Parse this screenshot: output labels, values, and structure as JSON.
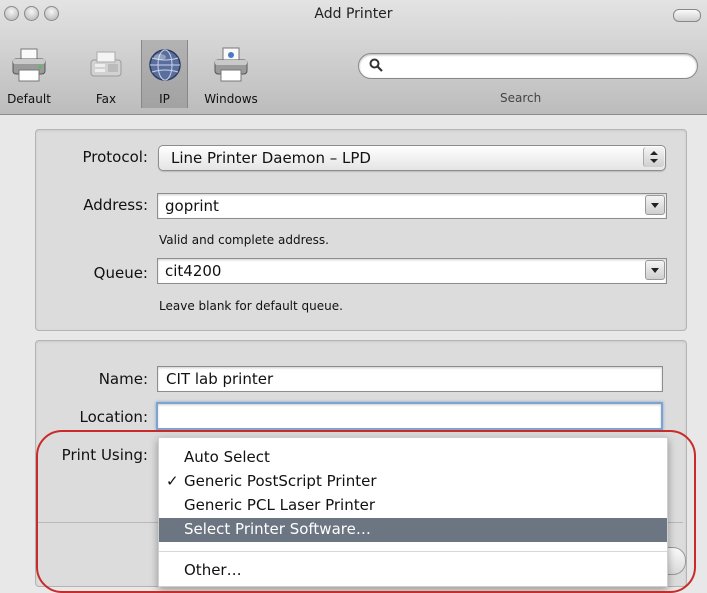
{
  "window": {
    "title": "Add Printer"
  },
  "toolbar": {
    "items": [
      {
        "label": "Default",
        "icon": "printer-icon"
      },
      {
        "label": "Fax",
        "icon": "fax-icon"
      },
      {
        "label": "IP",
        "icon": "globe-icon"
      },
      {
        "label": "Windows",
        "icon": "windows-printer-icon"
      }
    ],
    "selected": "IP",
    "search_label": "Search",
    "search_value": ""
  },
  "network": {
    "protocol_label": "Protocol:",
    "protocol_value": "Line Printer Daemon – LPD",
    "address_label": "Address:",
    "address_value": "goprint",
    "address_hint": "Valid and complete address.",
    "queue_label": "Queue:",
    "queue_value": "cit4200",
    "queue_hint": "Leave blank for default queue."
  },
  "details": {
    "name_label": "Name:",
    "name_value": "CIT lab printer",
    "location_label": "Location:",
    "location_value": "",
    "print_using_label": "Print Using:"
  },
  "menu": {
    "items": [
      {
        "label": "Auto Select",
        "checked": false,
        "highlighted": false
      },
      {
        "label": "Generic PostScript Printer",
        "checked": true,
        "highlighted": false
      },
      {
        "label": "Generic PCL Laser Printer",
        "checked": false,
        "highlighted": false
      },
      {
        "label": "Select Printer Software…",
        "checked": false,
        "highlighted": true
      },
      {
        "label": "Other…",
        "checked": false,
        "highlighted": false
      }
    ],
    "check_mark": "✓"
  },
  "colors": {
    "highlight": "#6b7682",
    "callout": "#c92a2a",
    "focus_ring": "#7ea3cf"
  }
}
